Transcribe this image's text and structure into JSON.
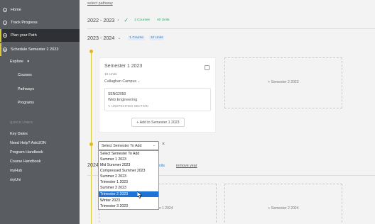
{
  "sidebar": {
    "nav": [
      {
        "label": "Home",
        "icon": "home-icon"
      },
      {
        "label": "Track Progress",
        "icon": "progress-icon"
      },
      {
        "label": "Plan your Path",
        "icon": "path-icon"
      },
      {
        "label": "Schedule Semester 2 2023",
        "icon": "schedule-icon"
      }
    ],
    "explore_label": "Explore",
    "explore_items": [
      "Courses",
      "Pathways",
      "Programs"
    ],
    "quick_links_label": "QUICK LINKS",
    "quick_links": [
      "Key Dates",
      "Need Help? AskUON",
      "Program Handbook",
      "Course Handbook",
      "myHub",
      "myUni"
    ]
  },
  "main": {
    "select_pathway_link": "select pathway",
    "year_2022": {
      "label": "2022 - 2023",
      "courses": "4 Courses",
      "units": "40 Units"
    },
    "year_2023": {
      "label": "2023 - 2024",
      "courses": "1 Course",
      "units": "10 Units"
    },
    "semester_card": {
      "title": "Semester 1 2023",
      "units": "10 Units",
      "campus": "Callaghan Campus",
      "course_code": "SENG2050",
      "course_name": "Web Engineering",
      "course_section": "UNSPECIFIED SECTION",
      "add_button": "+ Add to Semester 1 2023"
    },
    "placeholder_sem2_2023": "+ Semester 2 2023",
    "select_semester": {
      "current": "Select Semester To Add",
      "options": [
        "Select Semester To Add",
        "Summer 1 2023",
        "Mid Summer 2023",
        "Compressed Summer 2023",
        "Summer 2 2023",
        "Trimester 1 2023",
        "Summer 3 2023",
        "Trimester 2 2023",
        "Winter 2023",
        "Trimester 3 2023"
      ],
      "highlighted_index": 7
    },
    "year_2024_fragment": "2024",
    "units_fragment": "nits",
    "remove_year_link": "remove year",
    "placeholder_sem1_2024": "+ Semester 1 2024",
    "placeholder_sem2_2024": "+ Semester 2 2024"
  },
  "colors": {
    "accent": "#d7c93a",
    "highlight": "#1e74d6",
    "green": "#2aa55f",
    "blue": "#2e7cc9"
  }
}
